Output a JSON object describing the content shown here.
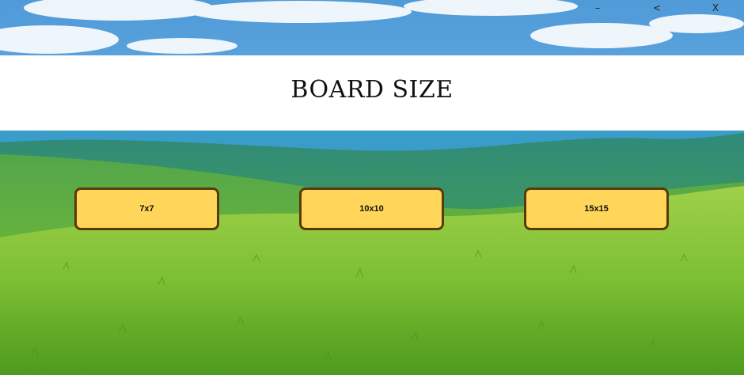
{
  "window_controls": {
    "minimize_label": "–",
    "back_label": "<",
    "close_label": "X"
  },
  "header": {
    "title": "BOARD SIZE"
  },
  "board_sizes": [
    {
      "label": "7x7"
    },
    {
      "label": "10x10"
    },
    {
      "label": "15x15"
    }
  ],
  "colors": {
    "sky": "#6fb0e0",
    "banner": "#ffffff",
    "button_fill": "#ffd65a",
    "button_border": "#5a3a0a",
    "grass": "#7cc23a"
  }
}
